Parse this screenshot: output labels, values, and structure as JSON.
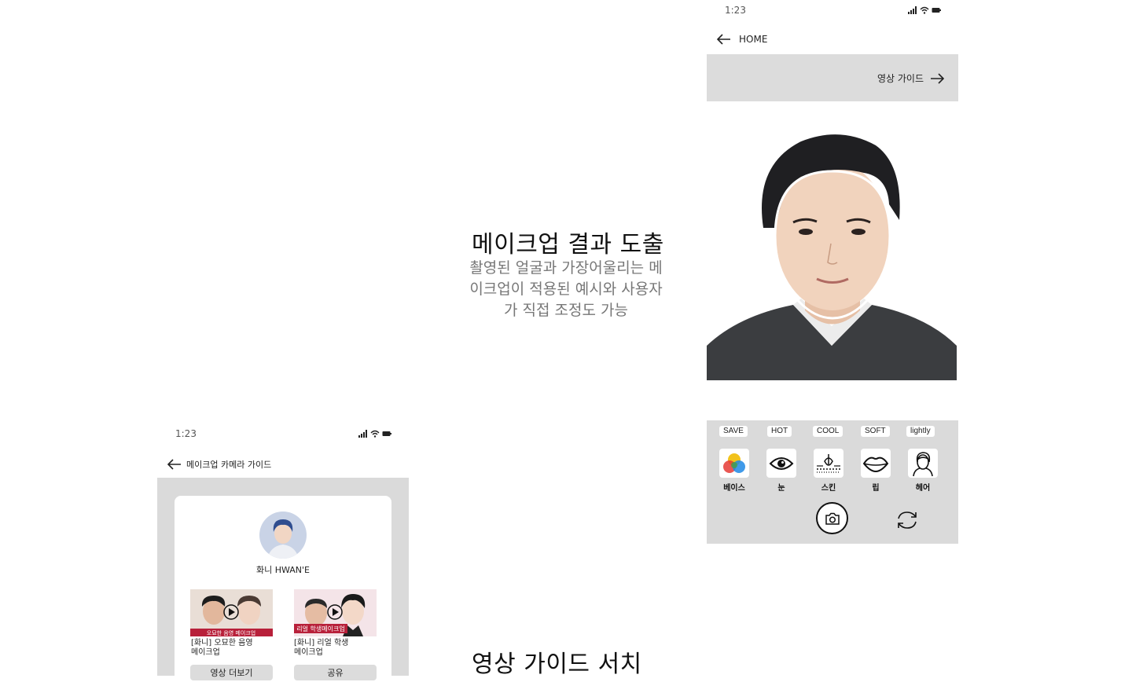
{
  "captions": {
    "result_title": "메이크업 결과 도출",
    "result_desc": "촬영된 얼굴과 가장어울리는 메이크업이 적용된 예시와 사용자가 직접 조정도 가능",
    "search_title": "영상 가이드 서치"
  },
  "right_phone": {
    "status_time": "1:23",
    "nav_label": "HOME",
    "guide_link": "영상 가이드",
    "presets": [
      "SAVE",
      "HOT",
      "COOL",
      "SOFT",
      "lightly"
    ],
    "tools": [
      {
        "label": "베이스",
        "icon": "color-palette-icon"
      },
      {
        "label": "눈",
        "icon": "eye-icon"
      },
      {
        "label": "스킨",
        "icon": "skin-icon"
      },
      {
        "label": "립",
        "icon": "lips-icon"
      },
      {
        "label": "헤어",
        "icon": "hair-icon"
      }
    ]
  },
  "left_phone": {
    "status_time": "1:23",
    "nav_label": "메이크업 카메라 가이드",
    "creator_name": "화니 HWAN'E",
    "videos": [
      {
        "thumb_text": "오묘한 음영 메이크업",
        "caption": "[화니] 오묘한 음영\n메이크업",
        "button": "영상 더보기"
      },
      {
        "thumb_text": "리얼 학생메이크업",
        "caption": "[화니] 리얼 학생\n메이크업",
        "button": "공유"
      }
    ]
  },
  "colors": {
    "panel_gray": "#dadada",
    "text_gray": "#777777",
    "thumb_banner": "#b8203a"
  }
}
